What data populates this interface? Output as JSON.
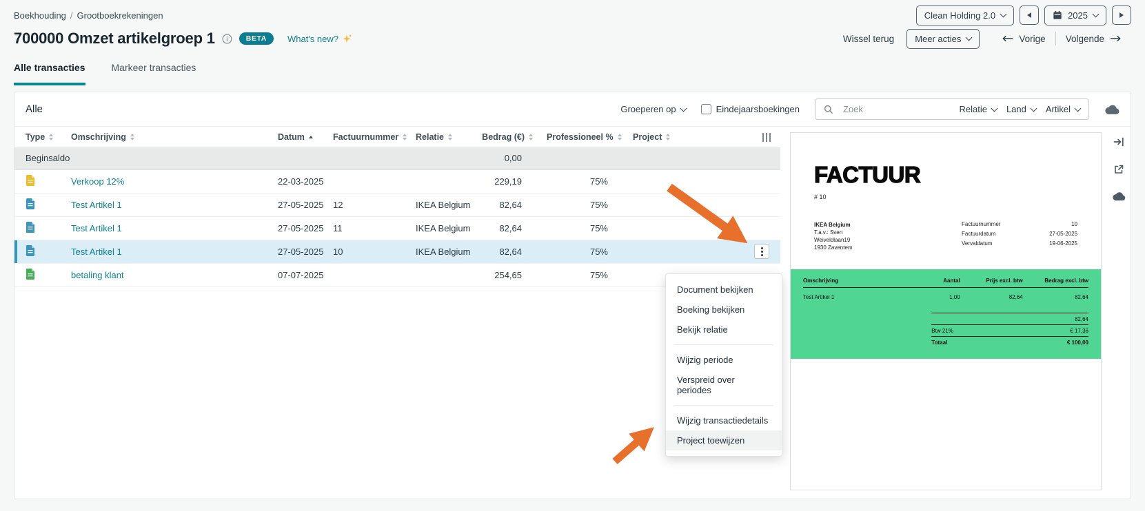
{
  "breadcrumb": {
    "items": [
      "Boekhouding",
      "Grootboekrekeningen"
    ],
    "separator": "/"
  },
  "workspace": {
    "company_selector": "Clean Holding 2.0",
    "year_selector": "2025"
  },
  "page_header": {
    "title": "700000 Omzet artikelgroep 1",
    "beta_badge": "BETA",
    "whats_new_link": "What's new?",
    "wissel_terug": "Wissel terug",
    "meer_acties": "Meer acties",
    "vorige": "Vorige",
    "volgende": "Volgende"
  },
  "tabs": {
    "alle_transacties": "Alle transacties",
    "markeer_transacties": "Markeer transacties"
  },
  "toolbar": {
    "section_title": "Alle",
    "group_by_label": "Groeperen op",
    "year_end_label": "Eindejaarsboekingen",
    "year_end_checked": false,
    "search_placeholder": "Zoek",
    "filter_relatie": "Relatie",
    "filter_land": "Land",
    "filter_artikel": "Artikel"
  },
  "table": {
    "columns": [
      "Type",
      "Omschrijving",
      "Datum",
      "Factuurnummer",
      "Relatie",
      "Bedrag (€)",
      "Professioneel %",
      "Project"
    ],
    "sorted_column": "Datum",
    "begin_row": {
      "label": "Beginsaldo",
      "amount": "0,00"
    },
    "rows": [
      {
        "icon": "journal-document-icon",
        "omschrijving": "Verkoop 12%",
        "datum": "22-03-2025",
        "factuurnummer": "",
        "relatie": "",
        "bedrag": "229,19",
        "professioneel": "75%",
        "project": ""
      },
      {
        "icon": "sales-invoice-icon",
        "omschrijving": "Test Artikel 1",
        "datum": "27-05-2025",
        "factuurnummer": "12",
        "relatie": "IKEA Belgium",
        "bedrag": "82,64",
        "professioneel": "75%",
        "project": ""
      },
      {
        "icon": "sales-invoice-icon",
        "omschrijving": "Test Artikel 1",
        "datum": "27-05-2025",
        "factuurnummer": "11",
        "relatie": "IKEA Belgium",
        "bedrag": "82,64",
        "professioneel": "75%",
        "project": ""
      },
      {
        "icon": "sales-invoice-icon",
        "omschrijving": "Test Artikel 1",
        "datum": "27-05-2025",
        "factuurnummer": "10",
        "relatie": "IKEA Belgium",
        "bedrag": "82,64",
        "professioneel": "75%",
        "project": "",
        "selected": true
      },
      {
        "icon": "payment-document-icon",
        "omschrijving": "betaling klant",
        "datum": "07-07-2025",
        "factuurnummer": "",
        "relatie": "",
        "bedrag": "254,65",
        "professioneel": "75%",
        "project": ""
      }
    ]
  },
  "context_menu": {
    "groups": [
      {
        "items": [
          "Document bekijken",
          "Boeking bekijken",
          "Bekijk relatie"
        ]
      },
      {
        "items": [
          "Wijzig periode",
          "Verspreid over periodes"
        ]
      },
      {
        "items": [
          "Wijzig transactiedetails",
          "Project toewijzen"
        ]
      }
    ],
    "highlighted_item": "Project toewijzen"
  },
  "preview": {
    "doc_title": "FACTUUR",
    "doc_number": "# 10",
    "recipient": [
      "IKEA Belgium",
      "T.a.v.: Sven",
      "Weiveldlaan19",
      "1930 Zaventem"
    ],
    "fields": [
      {
        "label": "Factuurnummer",
        "value": "10"
      },
      {
        "label": "Factuurdatum",
        "value": "27-05-2025"
      },
      {
        "label": "Vervaldatum",
        "value": "19-06-2025"
      }
    ],
    "line_table": {
      "headers": [
        "Omschrijving",
        "Aantal",
        "Prijs excl. btw",
        "Bedrag excl. btw"
      ],
      "rows": [
        [
          "Test Artikel 1",
          "1,00",
          "82,64",
          "82,64"
        ]
      ],
      "subtotal": "82,64",
      "vat_label": "Btw 21%",
      "vat_value": "€ 17,36",
      "total_label": "Totaal",
      "total_value": "€ 100,00"
    }
  },
  "icons": {
    "search": "magnifier",
    "export": "cloud-download",
    "row_actions": "kebab",
    "column_settings": "vertical-bars",
    "whats_new": "sparkle",
    "title_info": "info-circle",
    "year": "calendar"
  },
  "colors": {
    "accent_teal": "#0b8590",
    "link_teal": "#0e8390",
    "beta_badge": "#0b7c91",
    "selected_row_bg": "#dbeef8",
    "selected_row_bar": "#3397be",
    "annotation_orange": "#e8702d",
    "invoice_table_green": "#50d593"
  }
}
